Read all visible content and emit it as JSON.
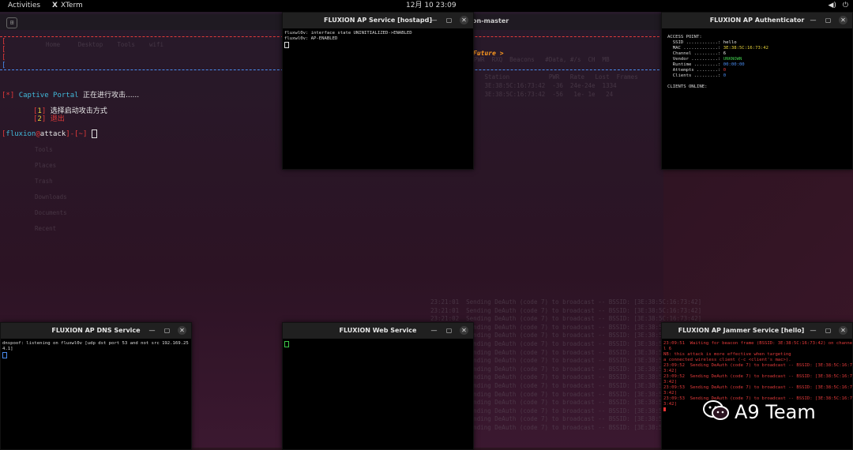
{
  "topbar": {
    "activities": "Activities",
    "app_name": "XTerm",
    "clock": "12月 10  23:09"
  },
  "main_terminal": {
    "title_partial": "on-master",
    "menu_tag": "[*]",
    "menu_title": "Captive Portal",
    "menu_status": "正在进行攻击......",
    "options": [
      {
        "num": "1",
        "label": "选择启动攻击方式"
      },
      {
        "num": "2",
        "label": "退出"
      }
    ],
    "prompt_user": "fluxion",
    "prompt_at": "@",
    "prompt_host": "attack",
    "prompt_path": "[~]",
    "future_text": "Future >"
  },
  "hostapd_window": {
    "title": "FLUXION AP Service [hostapd]",
    "lines": [
      "fluxwl0v: interface state UNINITIALIZED->ENABLED",
      "fluxwl0v: AP-ENABLED"
    ]
  },
  "auth_window": {
    "title": "FLUXION AP Authenticator",
    "header": "ACCESS POINT:",
    "fields": [
      {
        "label": "  SSID ............:",
        "value": "hello",
        "color": "#e8e8e8"
      },
      {
        "label": "  MAC .............:",
        "value": "3E:38:5C:16:73:42",
        "color": "#e8d33a"
      },
      {
        "label": "  Channel .........:",
        "value": "6",
        "color": "#e8e8e8"
      },
      {
        "label": "  Vendor ..........:",
        "value": "UNKNOWN",
        "color": "#3ec74a"
      },
      {
        "label": "  Runtime .........:",
        "value": "00:00:00",
        "color": "#4a8cf0"
      },
      {
        "label": "  Attempts ........:",
        "value": "0",
        "color": "#e23a3a"
      },
      {
        "label": "  Clients .........:",
        "value": "0",
        "color": "#4a8cf0"
      }
    ],
    "clients_header": "CLIENTS ONLINE:"
  },
  "dns_window": {
    "title": "FLUXION AP DNS Service",
    "lines": [
      "dnspoof: listening on fluxwl0v [udp dst port 53 and not src 192.169.25",
      "4.1]"
    ]
  },
  "web_window": {
    "title": "FLUXION Web Service"
  },
  "jammer_window": {
    "title": "FLUXION AP Jammer Service [hello]",
    "lines": [
      "23:09:51  Waiting for beacon frame (BSSID: 3E:38:5C:16:73:42) on channe",
      "l 6",
      "NB: this attack is more effective when targeting",
      "a connected wireless client (-c <client's mac>).",
      "23:09:52  Sending DeAuth (code 7) to broadcast -- BSSID: [3E:38:5C:16:7",
      "3:42]",
      "23:09:52  Sending DeAuth (code 7) to broadcast -- BSSID: [3E:38:5C:16:7",
      "3:42]",
      "23:09:53  Sending DeAuth (code 7) to broadcast -- BSSID: [3E:38:5C:16:7",
      "3:42]",
      "23:09:53  Sending DeAuth (code 7) to broadcast -- BSSID: [3E:38:5C:16:7",
      "3:42]"
    ]
  },
  "watermark": {
    "text": "A9 Team"
  },
  "colors": {
    "accent_red": "#e23a3a",
    "accent_blue": "#4a8cf0",
    "cyan": "#41b8d8",
    "green": "#3ec74a",
    "orange": "#ff9a1f"
  }
}
